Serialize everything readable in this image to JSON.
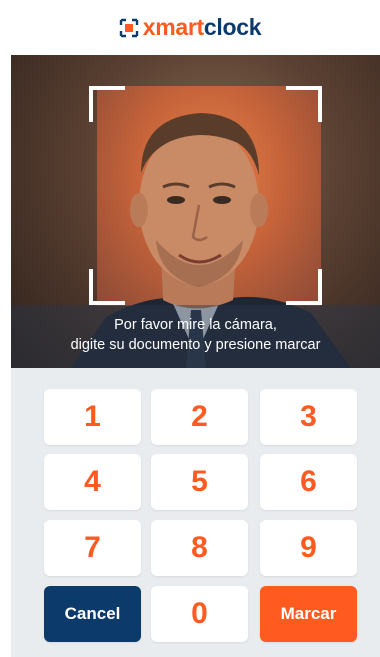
{
  "logo": {
    "x": "x",
    "mart": "mart",
    "clock": "clock"
  },
  "camera": {
    "instructions_line1": "Por favor mire la cámara,",
    "instructions_line2": "digite su documento y presione marcar"
  },
  "keypad": {
    "keys": [
      "1",
      "2",
      "3",
      "4",
      "5",
      "6",
      "7",
      "8",
      "9"
    ],
    "zero": "0",
    "cancel_label": "Cancel",
    "mark_label": "Marcar"
  },
  "colors": {
    "accent": "#ff5a1f",
    "brand_dark": "#0c3a6b",
    "keypad_bg": "#e9ecef"
  }
}
